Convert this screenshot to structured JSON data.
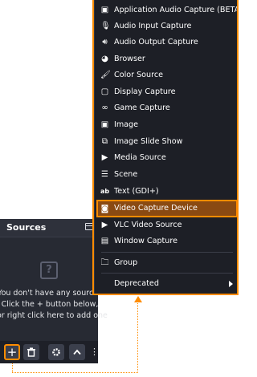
{
  "sources_dock": {
    "title": "Sources",
    "empty_lines": [
      "You don't have any sources",
      "Click the + button below,",
      "or right click here to add one"
    ],
    "toolbar": {
      "add": "+",
      "more": "⋮"
    }
  },
  "menu": {
    "items": [
      {
        "label": "Application Audio Capture (BETA)",
        "icon": "app-audio-icon"
      },
      {
        "label": "Audio Input Capture",
        "icon": "microphone-icon"
      },
      {
        "label": "Audio Output Capture",
        "icon": "speaker-icon"
      },
      {
        "label": "Browser",
        "icon": "globe-icon"
      },
      {
        "label": "Color Source",
        "icon": "brush-icon"
      },
      {
        "label": "Display Capture",
        "icon": "monitor-icon"
      },
      {
        "label": "Game Capture",
        "icon": "gamepad-icon"
      },
      {
        "label": "Image",
        "icon": "image-icon"
      },
      {
        "label": "Image Slide Show",
        "icon": "slideshow-icon"
      },
      {
        "label": "Media Source",
        "icon": "play-icon"
      },
      {
        "label": "Scene",
        "icon": "list-icon"
      },
      {
        "label": "Text (GDI+)",
        "icon": "text-icon"
      },
      {
        "label": "Video Capture Device",
        "icon": "camera-icon",
        "highlighted": true
      },
      {
        "label": "VLC Video Source",
        "icon": "play-icon"
      },
      {
        "label": "Window Capture",
        "icon": "window-icon"
      },
      {
        "label": "Group",
        "icon": "folder-icon"
      },
      {
        "label": "Deprecated",
        "icon": "",
        "submenu": true
      }
    ]
  },
  "colors": {
    "accent": "#ff8c00",
    "menu_bg": "#1d1f26",
    "dock_bg": "#272a33",
    "highlight_bg": "#8a4a12"
  }
}
